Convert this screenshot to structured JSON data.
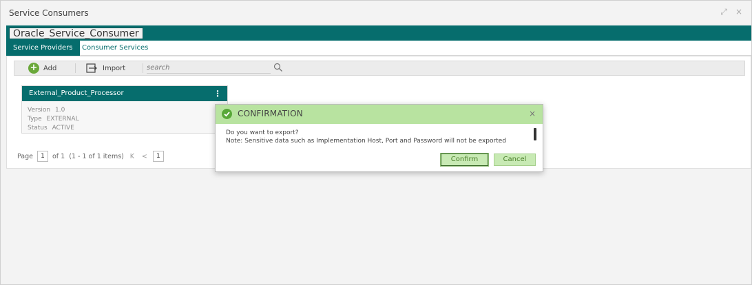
{
  "window": {
    "title": "Service Consumers",
    "controls": {
      "restore": "⤢",
      "close": "×"
    }
  },
  "consumer": {
    "name": "Oracle_Service_Consumer"
  },
  "tabs": [
    {
      "label": "Service Providers",
      "active": true
    },
    {
      "label": "Consumer Services",
      "active": false
    }
  ],
  "toolbar": {
    "add_label": "Add",
    "import_label": "Import",
    "search_placeholder": "search"
  },
  "card": {
    "title": "External_Product_Processor",
    "menu": "⋮",
    "version_label": "Version",
    "version_value": "1.0",
    "type_label": "Type",
    "type_value": "EXTERNAL",
    "status_label": "Status",
    "status_value": "ACTIVE"
  },
  "pager": {
    "page_label": "Page",
    "current_page": "1",
    "of_text": "of 1",
    "items_text": "(1 - 1 of 1 items)",
    "first": "K",
    "prev": "<",
    "page_button": "1"
  },
  "dialog": {
    "title": "CONFIRMATION",
    "close": "×",
    "line1": "Do you want to export?",
    "line2": "Note: Sensitive data such as Implementation Host, Port and Password will not be exported",
    "confirm_label": "Confirm",
    "cancel_label": "Cancel"
  },
  "colors": {
    "primary_teal": "#066d6d",
    "dialog_header": "#b8e3a0",
    "button_green": "#c8eab4",
    "check_green": "#58a838"
  }
}
